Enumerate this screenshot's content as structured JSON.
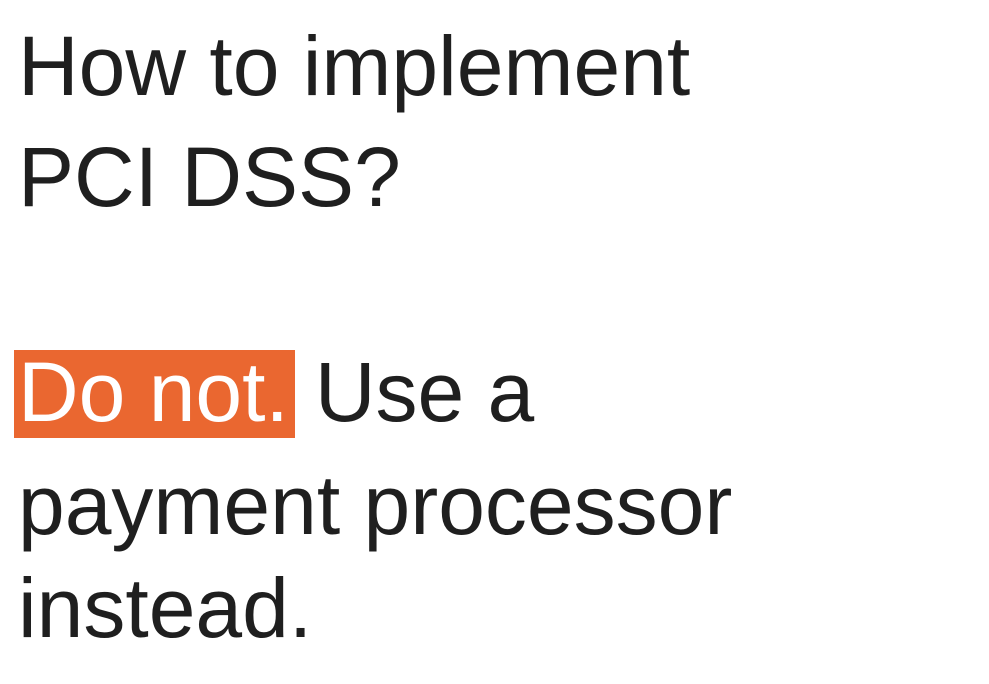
{
  "question": {
    "line1": "How to implement",
    "line2": "PCI DSS?"
  },
  "answer": {
    "highlight": "Do not.",
    "line1_rest": "Use a",
    "line2": "payment processor",
    "line3": "instead."
  },
  "colors": {
    "text": "#1f1f1f",
    "highlight_bg": "#ea6730",
    "highlight_text": "#ffffff",
    "background": "#ffffff"
  }
}
